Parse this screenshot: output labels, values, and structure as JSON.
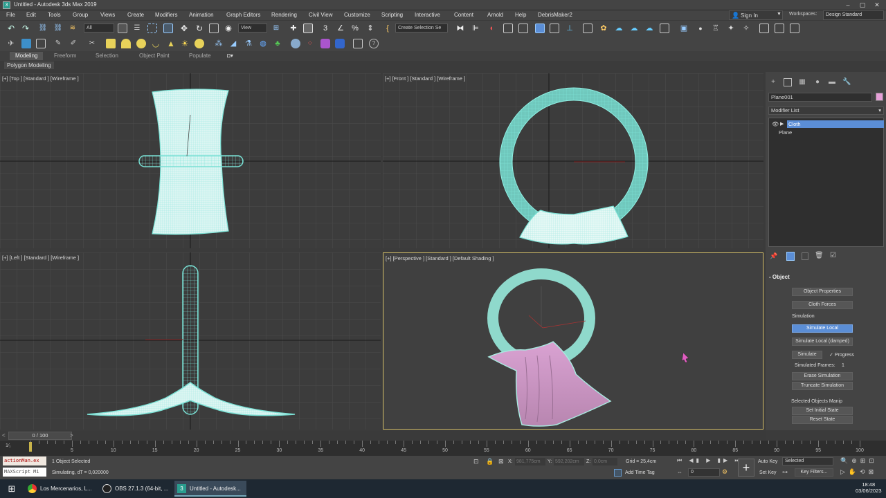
{
  "window": {
    "title": "Untitled - Autodesk 3ds Max 2019",
    "minimize": "–",
    "maximize": "▢",
    "close": "✕"
  },
  "menu": [
    "File",
    "Edit",
    "Tools",
    "Group",
    "Views",
    "Create",
    "Modifiers",
    "Animation",
    "Graph Editors",
    "Rendering",
    "Civil View",
    "Customize",
    "Scripting",
    "Interactive",
    "Content",
    "Arnold",
    "Help",
    "DebrisMaker2"
  ],
  "account": {
    "sign_in": "Sign In",
    "workspaces_label": "Workspaces:",
    "workspace": "Design Standard"
  },
  "toolbar": {
    "filter": "All",
    "ref_coord": "View",
    "selection_set": "Create Selection Se"
  },
  "ribbon": {
    "tabs": [
      "Modeling",
      "Freeform",
      "Selection",
      "Object Paint",
      "Populate"
    ],
    "active_tab": "Modeling",
    "panel": "Polygon Modeling"
  },
  "viewports": {
    "top": "[+] [Top ] [Standard ] [Wireframe ]",
    "front": "[+] [Front ] [Standard ] [Wireframe ]",
    "left": "[+] [Left ] [Standard ] [Wireframe ]",
    "perspective": "[+] [Perspective ] [Standard ] [Default Shading ]"
  },
  "command_panel": {
    "object_name": "Plane001",
    "object_color": "#e6a0d8",
    "modifier_list": "Modifier List",
    "stack": [
      "Cloth",
      "Plane"
    ],
    "rollout": "Object",
    "buttons": {
      "object_properties": "Object Properties",
      "cloth_forces": "Cloth Forces",
      "simulation_label": "Simulation",
      "simulate_local": "Simulate Local",
      "simulate_local_damped": "Simulate Local (damped)",
      "simulate": "Simulate",
      "progress": "Progress",
      "simulated_frames_label": "Simulated Frames:",
      "simulated_frames_value": "1",
      "erase_simulation": "Erase Simulation",
      "truncate_simulation": "Truncate Simulation",
      "selected_objects_label": "Selected Objects Manip",
      "set_initial_state": "Set Initial State",
      "reset_state": "Reset State"
    }
  },
  "timeline": {
    "current": "0 / 100",
    "ticks": [
      "5",
      "10",
      "15",
      "20",
      "25",
      "30",
      "35",
      "40",
      "45",
      "50",
      "55",
      "60",
      "65",
      "70",
      "75",
      "80",
      "85",
      "90",
      "95",
      "100"
    ]
  },
  "status": {
    "maxscript_1": "actionMan.ex",
    "maxscript_2": "MAXScript Mi",
    "selected": "1 Object Selected",
    "prompt": "Simulating, dT = 0,020000",
    "x_label": "X:",
    "x_value": "981,775cm",
    "y_label": "Y:",
    "y_value": "592,202cm",
    "z_label": "Z:",
    "z_value": "0,0cm",
    "grid": "Grid = 25,4cm",
    "add_time_tag": "Add Time Tag",
    "auto_key": "Auto Key",
    "set_key": "Set Key",
    "key_mode": "Selected",
    "key_filters": "Key Filters...",
    "frame": "0"
  },
  "taskbar": {
    "items": [
      "Los Mercenarios, L...",
      "OBS 27.1.3 (64-bit, ...",
      "Untitled - Autodesk..."
    ],
    "time": "18:48",
    "date": "03/06/2023"
  }
}
